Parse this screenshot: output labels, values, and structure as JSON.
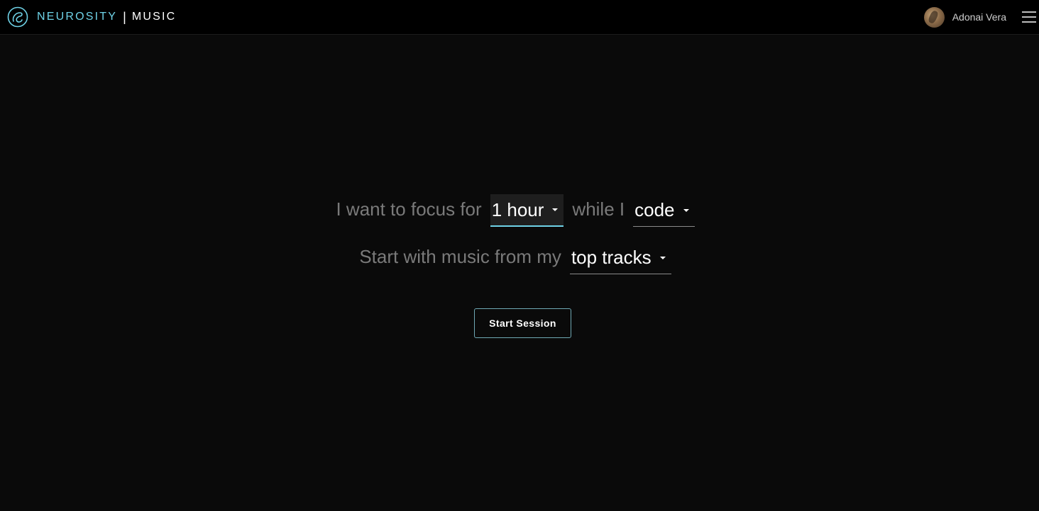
{
  "header": {
    "brand_name": "NEUROSITY",
    "brand_separator": "|",
    "product_name": "MUSIC",
    "logo_icon": "neurosity-logo-icon",
    "user_name": "Adonai Vera",
    "menu_icon": "hamburger-menu-icon"
  },
  "focus_form": {
    "line1_prefix": "I want to focus for",
    "duration_value": "1 hour",
    "line1_middle": "while I",
    "activity_value": "code",
    "line2_prefix": "Start with music from my",
    "source_value": "top tracks"
  },
  "actions": {
    "start_label": "Start Session"
  },
  "colors": {
    "accent": "#6fd3e8",
    "background": "#0a0a0a",
    "topbar": "#000000",
    "muted_text": "#7a7a7a"
  }
}
